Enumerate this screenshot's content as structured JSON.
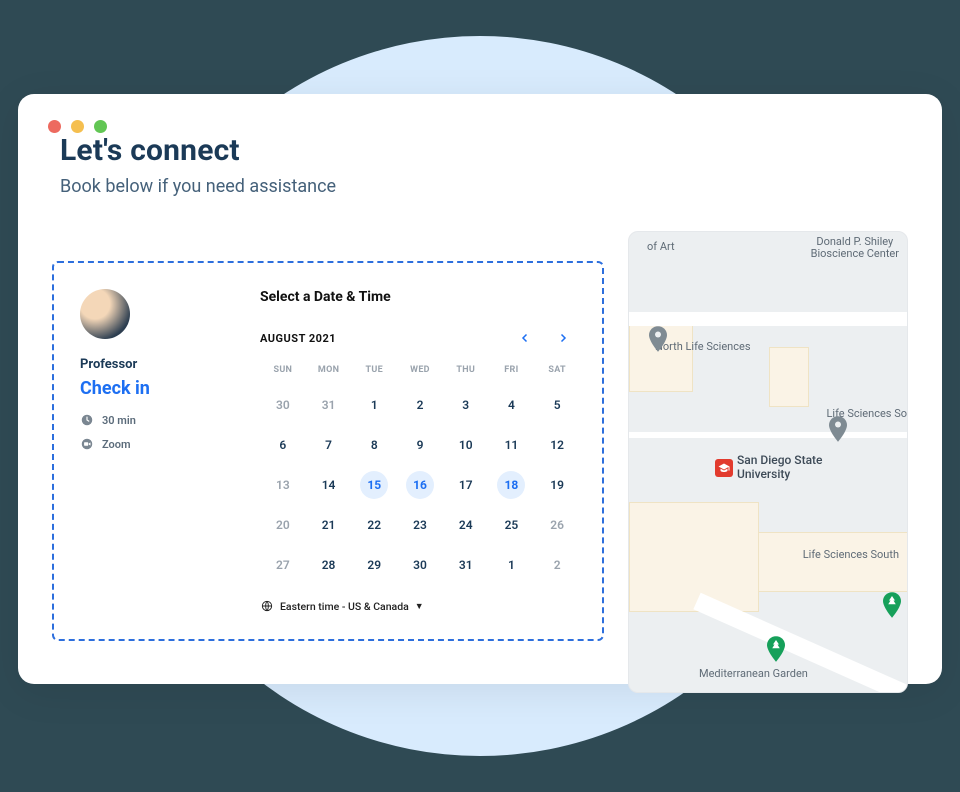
{
  "header": {
    "title": "Let's connect",
    "subtitle": "Book below if you need assistance"
  },
  "booking": {
    "panel_title": "Select a Date & Time",
    "host_role": "Professor",
    "event_title": "Check in",
    "duration": "30 min",
    "location": "Zoom",
    "month_label": "AUGUST 2021",
    "timezone_label": "Eastern time - US & Canada",
    "weekdays": [
      "SUN",
      "MON",
      "TUE",
      "WED",
      "THU",
      "FRI",
      "SAT"
    ],
    "days": [
      {
        "n": "30",
        "cur": false,
        "avail": false
      },
      {
        "n": "31",
        "cur": false,
        "avail": false
      },
      {
        "n": "1",
        "cur": true,
        "avail": false
      },
      {
        "n": "2",
        "cur": true,
        "avail": false
      },
      {
        "n": "3",
        "cur": true,
        "avail": false
      },
      {
        "n": "4",
        "cur": true,
        "avail": false
      },
      {
        "n": "5",
        "cur": true,
        "avail": false
      },
      {
        "n": "6",
        "cur": true,
        "avail": false
      },
      {
        "n": "7",
        "cur": true,
        "avail": false
      },
      {
        "n": "8",
        "cur": true,
        "avail": false
      },
      {
        "n": "9",
        "cur": true,
        "avail": false
      },
      {
        "n": "10",
        "cur": true,
        "avail": false
      },
      {
        "n": "11",
        "cur": true,
        "avail": false
      },
      {
        "n": "12",
        "cur": true,
        "avail": false
      },
      {
        "n": "13",
        "cur": false,
        "avail": false
      },
      {
        "n": "14",
        "cur": true,
        "avail": false
      },
      {
        "n": "15",
        "cur": true,
        "avail": true
      },
      {
        "n": "16",
        "cur": true,
        "avail": true
      },
      {
        "n": "17",
        "cur": true,
        "avail": false
      },
      {
        "n": "18",
        "cur": true,
        "avail": true
      },
      {
        "n": "19",
        "cur": true,
        "avail": false
      },
      {
        "n": "20",
        "cur": false,
        "avail": false
      },
      {
        "n": "21",
        "cur": true,
        "avail": false
      },
      {
        "n": "22",
        "cur": true,
        "avail": false
      },
      {
        "n": "23",
        "cur": true,
        "avail": false
      },
      {
        "n": "24",
        "cur": true,
        "avail": false
      },
      {
        "n": "25",
        "cur": true,
        "avail": false
      },
      {
        "n": "26",
        "cur": false,
        "avail": false
      },
      {
        "n": "27",
        "cur": false,
        "avail": false
      },
      {
        "n": "28",
        "cur": true,
        "avail": false
      },
      {
        "n": "29",
        "cur": true,
        "avail": false
      },
      {
        "n": "30",
        "cur": true,
        "avail": false
      },
      {
        "n": "31",
        "cur": true,
        "avail": false
      },
      {
        "n": "1",
        "cur": true,
        "avail": false
      },
      {
        "n": "2",
        "cur": false,
        "avail": false
      }
    ]
  },
  "map": {
    "center_label": "San Diego State University",
    "labels": {
      "top_left": "of Art",
      "top_right": "Donald P. Shiley\nBioscience Center",
      "mid_left": "North Life Sciences",
      "mid_right": "Life Sciences So",
      "lower_right": "Life Sciences South",
      "bottom": "Mediterranean Garden"
    }
  }
}
